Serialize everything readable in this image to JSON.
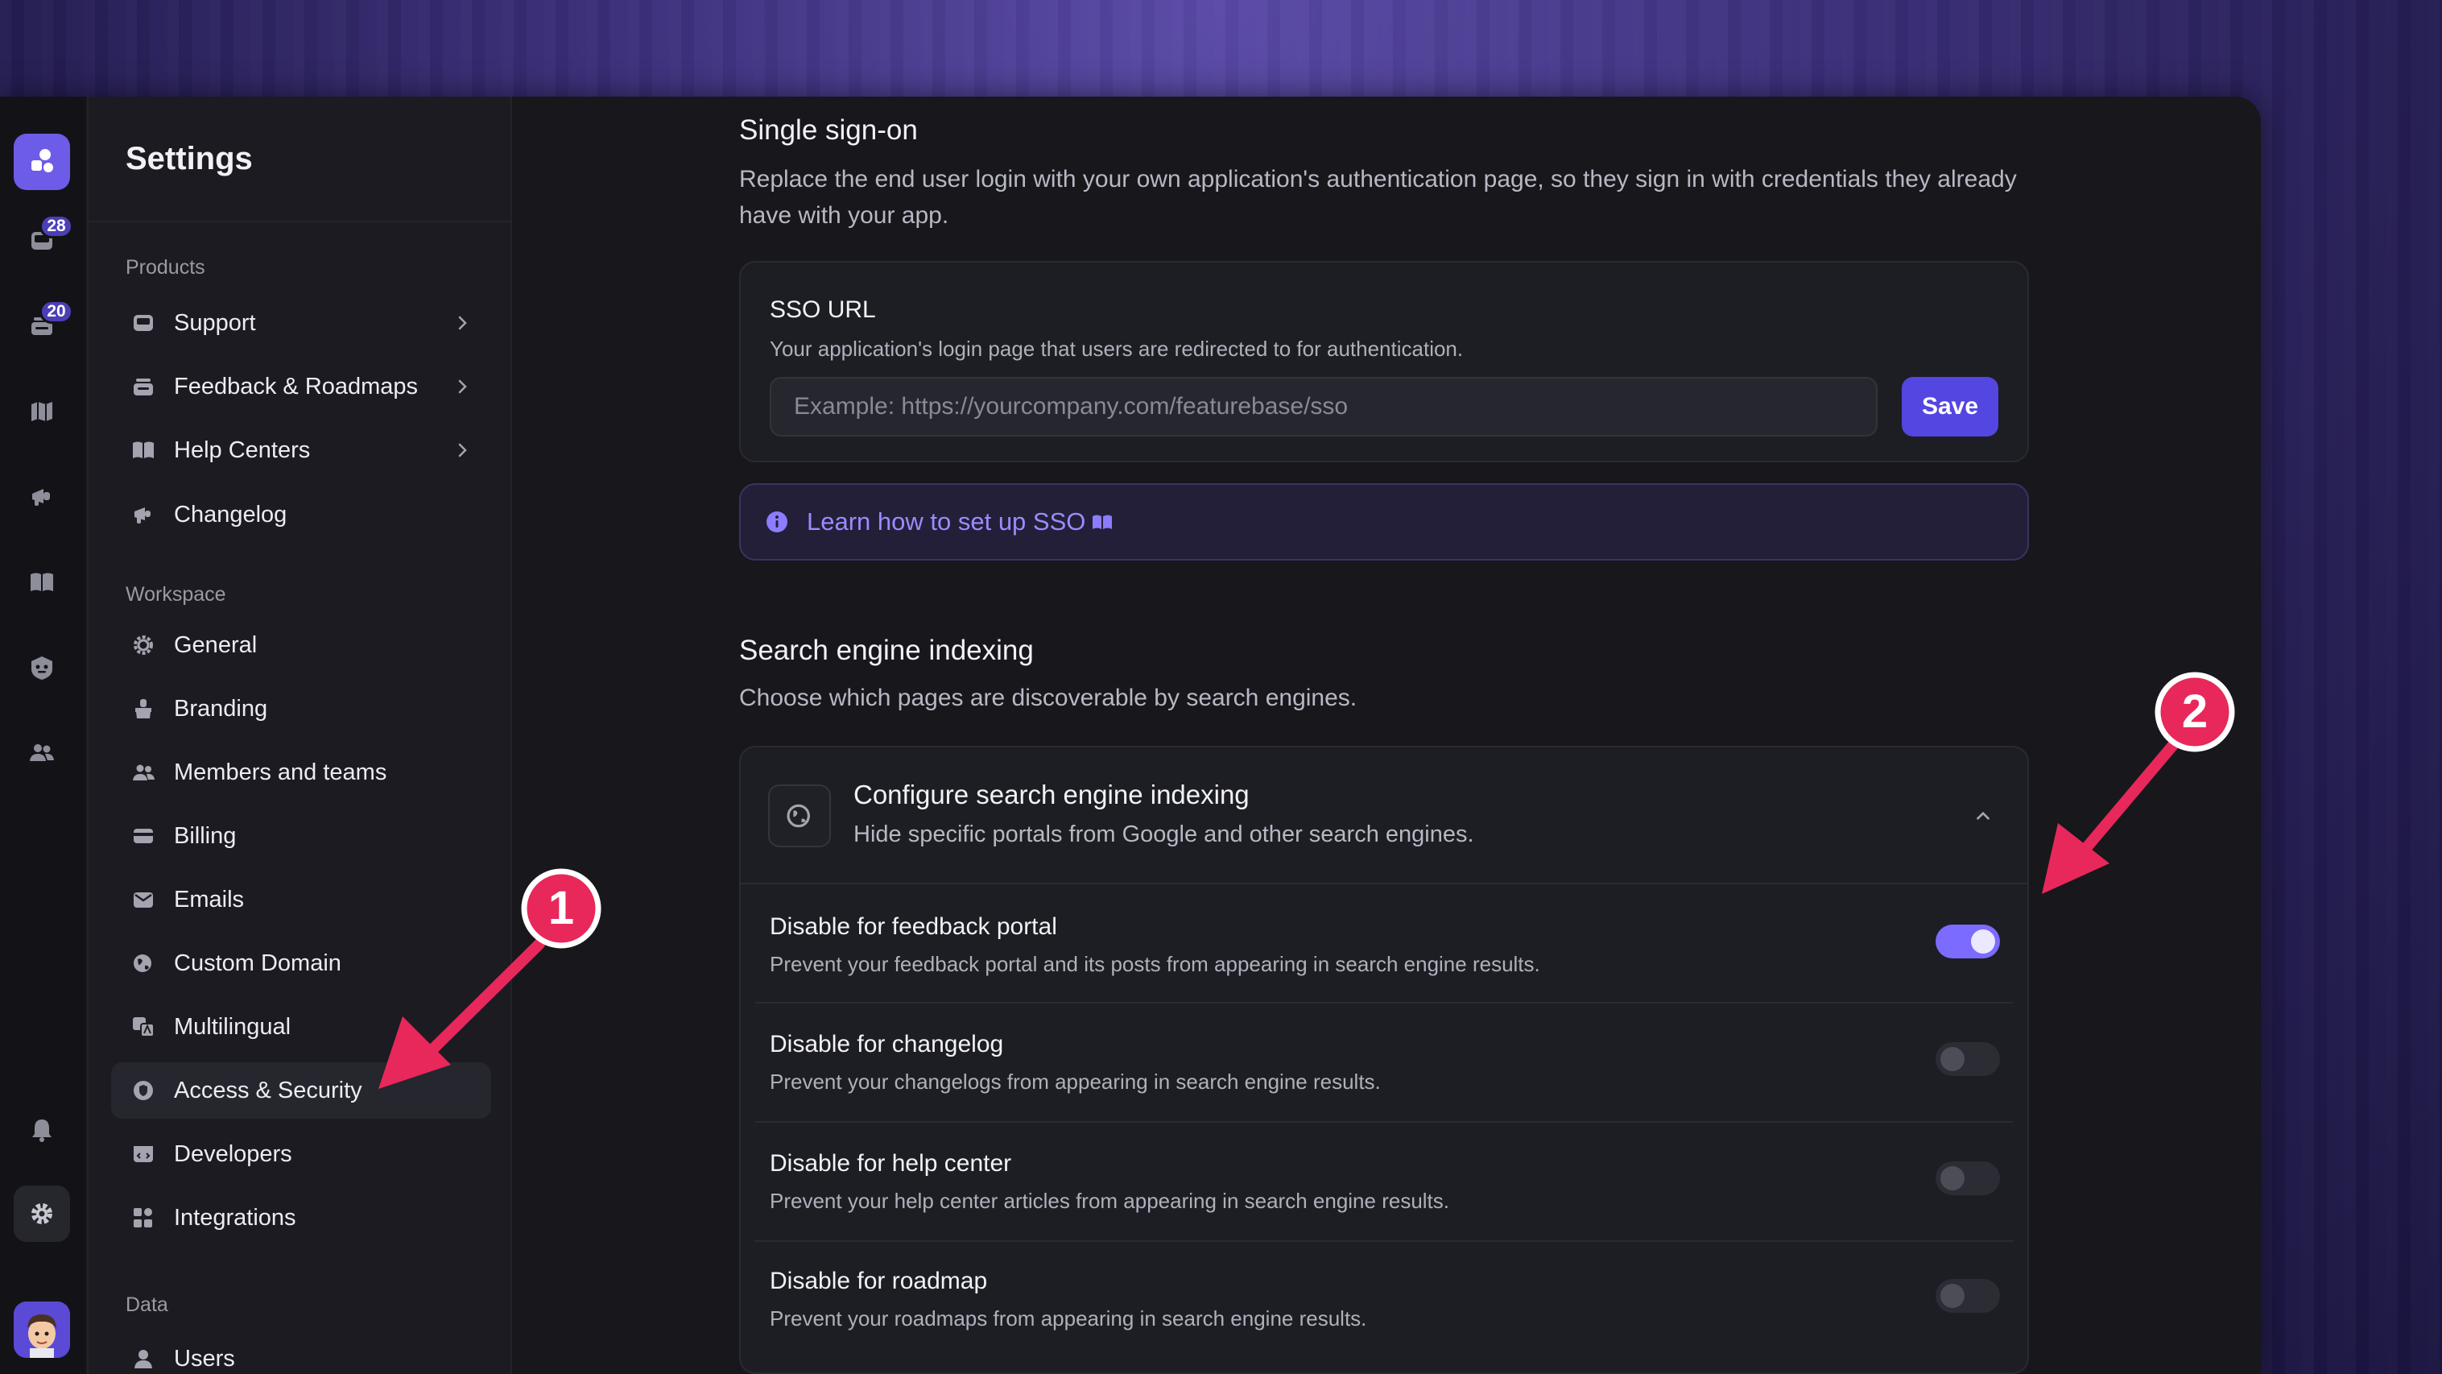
{
  "rail": {
    "badges": [
      "28",
      "20"
    ]
  },
  "sidebar": {
    "title": "Settings",
    "sections": {
      "products": "Products",
      "workspace": "Workspace",
      "data": "Data"
    },
    "products_items": [
      {
        "label": "Support",
        "icon": "inbox-icon"
      },
      {
        "label": "Feedback & Roadmaps",
        "icon": "stack-icon"
      },
      {
        "label": "Help Centers",
        "icon": "book-icon"
      },
      {
        "label": "Changelog",
        "icon": "megaphone-icon"
      }
    ],
    "workspace_items": [
      {
        "label": "General",
        "icon": "gear-icon"
      },
      {
        "label": "Branding",
        "icon": "brush-icon"
      },
      {
        "label": "Members and teams",
        "icon": "users-icon"
      },
      {
        "label": "Billing",
        "icon": "card-icon"
      },
      {
        "label": "Emails",
        "icon": "mail-icon"
      },
      {
        "label": "Custom Domain",
        "icon": "globe-icon"
      },
      {
        "label": "Multilingual",
        "icon": "translate-icon"
      },
      {
        "label": "Access & Security",
        "icon": "shield-icon"
      },
      {
        "label": "Developers",
        "icon": "code-icon"
      },
      {
        "label": "Integrations",
        "icon": "grid-icon"
      }
    ],
    "data_items": [
      {
        "label": "Users",
        "icon": "user-icon"
      }
    ]
  },
  "sso": {
    "heading": "Single sign-on",
    "description": "Replace the end user login with your own application's authentication page, so they sign in with credentials they already have with your app.",
    "url_title": "SSO URL",
    "url_description": "Your application's login page that users are redirected to for authentication.",
    "url_placeholder": "Example: https://yourcompany.com/featurebase/sso",
    "save_label": "Save",
    "learn_link": "Learn how to set up SSO"
  },
  "indexing": {
    "heading": "Search engine indexing",
    "description": "Choose which pages are discoverable by search engines.",
    "config_title": "Configure search engine indexing",
    "config_description": "Hide specific portals from Google and other search engines.",
    "options": [
      {
        "title": "Disable for feedback portal",
        "description": "Prevent your feedback portal and its posts from appearing in search engine results.",
        "enabled": true
      },
      {
        "title": "Disable for changelog",
        "description": "Prevent your changelogs from appearing in search engine results.",
        "enabled": false
      },
      {
        "title": "Disable for help center",
        "description": "Prevent your help center articles from appearing in search engine results.",
        "enabled": false
      },
      {
        "title": "Disable for roadmap",
        "description": "Prevent your roadmaps from appearing in search engine results.",
        "enabled": false
      }
    ]
  },
  "annotations": [
    "1",
    "2"
  ],
  "colors": {
    "accent": "#5446e0",
    "toggle_on": "#7b6bff",
    "arrow": "#e8285a"
  }
}
